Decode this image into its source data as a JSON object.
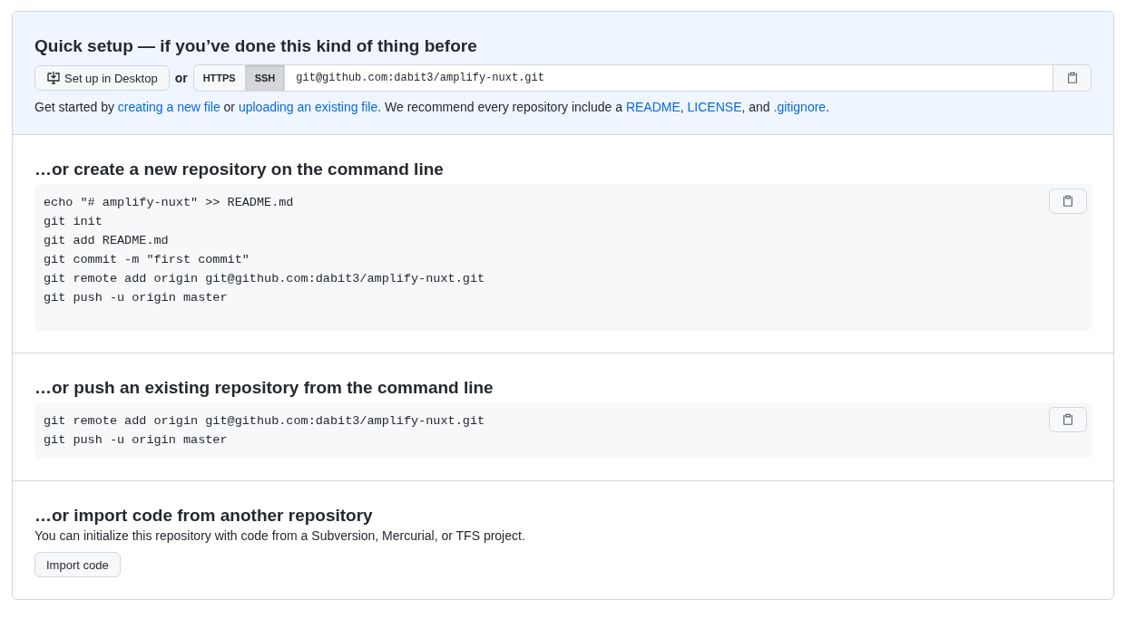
{
  "quick_setup": {
    "title": "Quick setup — if you’ve done this kind of thing before",
    "desktop_button": "Set up in Desktop",
    "or": "or",
    "protocols": [
      {
        "label": "HTTPS",
        "selected": false
      },
      {
        "label": "SSH",
        "selected": true
      }
    ],
    "clone_url": "git@github.com:dabit3/amplify-nuxt.git",
    "intro": [
      {
        "kind": "text",
        "text": "Get started by "
      },
      {
        "kind": "link",
        "text": "creating a new file"
      },
      {
        "kind": "text",
        "text": " or "
      },
      {
        "kind": "link",
        "text": "uploading an existing file"
      },
      {
        "kind": "text",
        "text": ". We recommend every repository include a "
      },
      {
        "kind": "link",
        "text": "README"
      },
      {
        "kind": "text",
        "text": ", "
      },
      {
        "kind": "link",
        "text": "LICENSE"
      },
      {
        "kind": "text",
        "text": ", and "
      },
      {
        "kind": "link",
        "text": ".gitignore"
      },
      {
        "kind": "text",
        "text": "."
      }
    ]
  },
  "sections": [
    {
      "kind": "code",
      "title": "…or create a new repository on the command line",
      "lines": [
        "echo \"# amplify-nuxt\" >> README.md",
        "git init",
        "git add README.md",
        "git commit -m \"first commit\"",
        "git remote add origin git@github.com:dabit3/amplify-nuxt.git",
        "git push -u origin master"
      ]
    },
    {
      "kind": "code",
      "title": "…or push an existing repository from the command line",
      "lines": [
        "git remote add origin git@github.com:dabit3/amplify-nuxt.git",
        "git push -u origin master"
      ]
    },
    {
      "kind": "import",
      "title": "…or import code from another repository",
      "text": "You can initialize this repository with code from a Subversion, Mercurial, or TFS project.",
      "button": "Import code"
    }
  ]
}
